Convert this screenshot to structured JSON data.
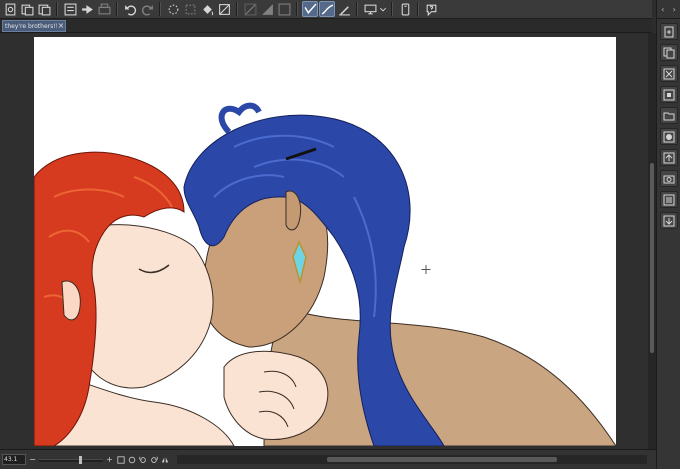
{
  "toolbar": {
    "icons": [
      "new-canvas-icon",
      "open-file-icon",
      "save-icon",
      "import-icon",
      "export-icon",
      "undo-icon",
      "redo-icon",
      "clear-icon",
      "select-all-icon",
      "fill-icon",
      "deselect-icon",
      "transform-icon",
      "ruler-icon",
      "line-vector-icon",
      "brush-select-icon",
      "pen-pressure-icon",
      "screen-mode-icon",
      "dropdown-chevron-icon",
      "device-icon",
      "help-icon"
    ]
  },
  "document": {
    "tab_title": "they're brothers!!",
    "tab_close": "×"
  },
  "status": {
    "zoom": "43.1",
    "zoom_out": "−",
    "zoom_in": "+"
  },
  "panel": {
    "arrows_left": "‹",
    "arrows_right": "›"
  },
  "colors": {
    "accent": "#55698a",
    "tab_bg": "#4a5c79",
    "ui_bg": "#2d2d2d"
  }
}
